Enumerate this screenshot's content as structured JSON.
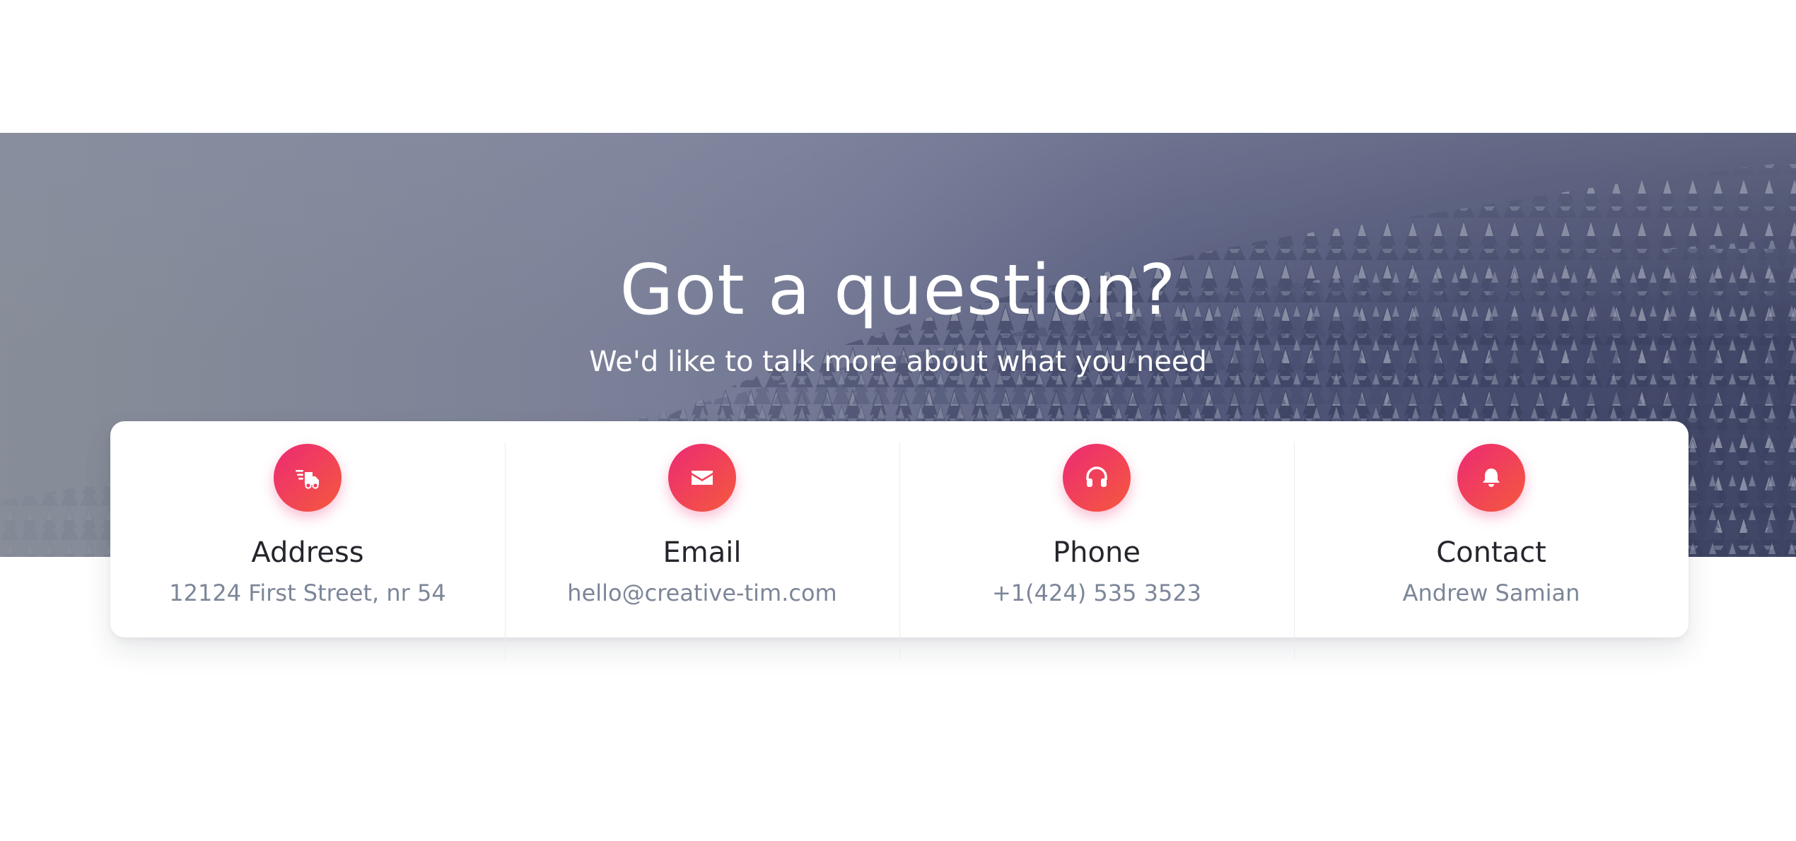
{
  "hero": {
    "title": "Got a question?",
    "subtitle": "We'd like to talk more about what you need"
  },
  "info_items": [
    {
      "icon": "delivery-truck-icon",
      "title": "Address",
      "text": "12124 First Street, nr 54"
    },
    {
      "icon": "envelope-icon",
      "title": "Email",
      "text": "hello@creative-tim.com"
    },
    {
      "icon": "headphones-icon",
      "title": "Phone",
      "text": "+1(424) 535 3523"
    },
    {
      "icon": "bell-icon",
      "title": "Contact",
      "text": "Andrew Samian"
    }
  ],
  "colors": {
    "icon_gradient_start": "#ec2a74",
    "icon_gradient_end": "#f5593d",
    "title_text": "#25262d",
    "muted_text": "#7c8698"
  }
}
